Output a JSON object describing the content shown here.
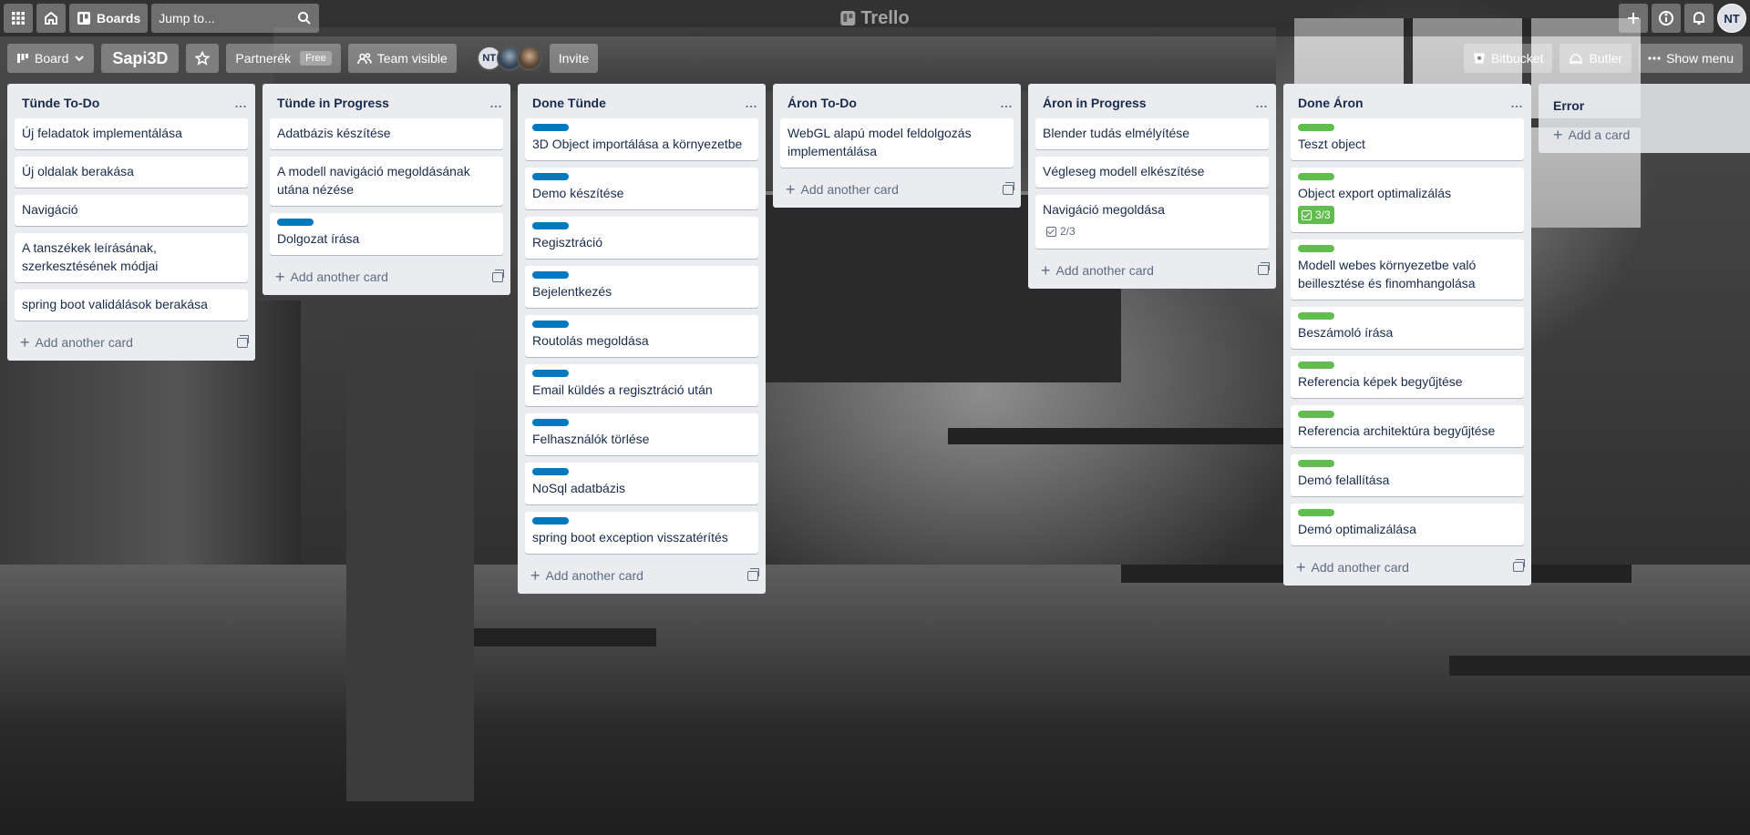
{
  "header": {
    "boards_label": "Boards",
    "search_placeholder": "Jump to...",
    "logo_text": "Trello",
    "user_initials": "NT"
  },
  "board": {
    "view_label": "Board",
    "name": "Sapi3D",
    "team_name": "Partnerék",
    "team_badge": "Free",
    "visibility_label": "Team visible",
    "member_initials": "NT",
    "invite_label": "Invite",
    "bitbucket_label": "Bitbucket",
    "butler_label": "Butler",
    "show_menu_label": "Show menu"
  },
  "add_another_card": "Add another card",
  "add_a_card": "Add a card",
  "label_colors": {
    "blue": "#0079bf",
    "green": "#61bd4f"
  },
  "lists": [
    {
      "title": "Tünde To-Do",
      "cards": [
        {
          "title": "Új feladatok implementálása"
        },
        {
          "title": "Új oldalak berakása"
        },
        {
          "title": "Navigáció"
        },
        {
          "title": "A tanszékek leírásának, szerkesztésének módjai"
        },
        {
          "title": "spring boot validálások berakása"
        }
      ]
    },
    {
      "title": "Tünde in Progress",
      "cards": [
        {
          "title": "Adatbázis készítése"
        },
        {
          "title": "A modell navigáció megoldásának utána nézése"
        },
        {
          "title": "Dolgozat írása",
          "label": "blue"
        }
      ]
    },
    {
      "title": "Done Tünde",
      "cards": [
        {
          "title": "3D Object importálása a környezetbe",
          "label": "blue"
        },
        {
          "title": "Demo készítése",
          "label": "blue"
        },
        {
          "title": "Regisztráció",
          "label": "blue"
        },
        {
          "title": "Bejelentkezés",
          "label": "blue"
        },
        {
          "title": "Routolás megoldása",
          "label": "blue"
        },
        {
          "title": "Email küldés a regisztráció után",
          "label": "blue"
        },
        {
          "title": "Felhasználók törlése",
          "label": "blue"
        },
        {
          "title": "NoSql adatbázis",
          "label": "blue"
        },
        {
          "title": "spring boot exception visszatérítés",
          "label": "blue"
        }
      ]
    },
    {
      "title": "Áron To-Do",
      "cards": [
        {
          "title": "WebGL alapú model feldolgozás implementálása"
        }
      ]
    },
    {
      "title": "Áron in Progress",
      "cards": [
        {
          "title": "Blender tudás elmélyítése"
        },
        {
          "title": "Végleseg modell elkészítése"
        },
        {
          "title": "Navigáció megoldása",
          "checklist": "2/3"
        }
      ]
    },
    {
      "title": "Done Áron",
      "cards": [
        {
          "title": "Teszt object",
          "label": "green"
        },
        {
          "title": "Object export optimalizálás",
          "label": "green",
          "checklist": "3/3",
          "checklist_done": true
        },
        {
          "title": "Modell webes környezetbe való beillesztése és finomhangolása",
          "label": "green"
        },
        {
          "title": "Beszámoló írása",
          "label": "green"
        },
        {
          "title": "Referencia képek begyűjtése",
          "label": "green"
        },
        {
          "title": "Referencia architektúra begyűjtése",
          "label": "green"
        },
        {
          "title": "Demó felallítása",
          "label": "green"
        },
        {
          "title": "Demó optimalizálása",
          "label": "green"
        }
      ]
    }
  ],
  "partial_list": {
    "title": "Error"
  }
}
